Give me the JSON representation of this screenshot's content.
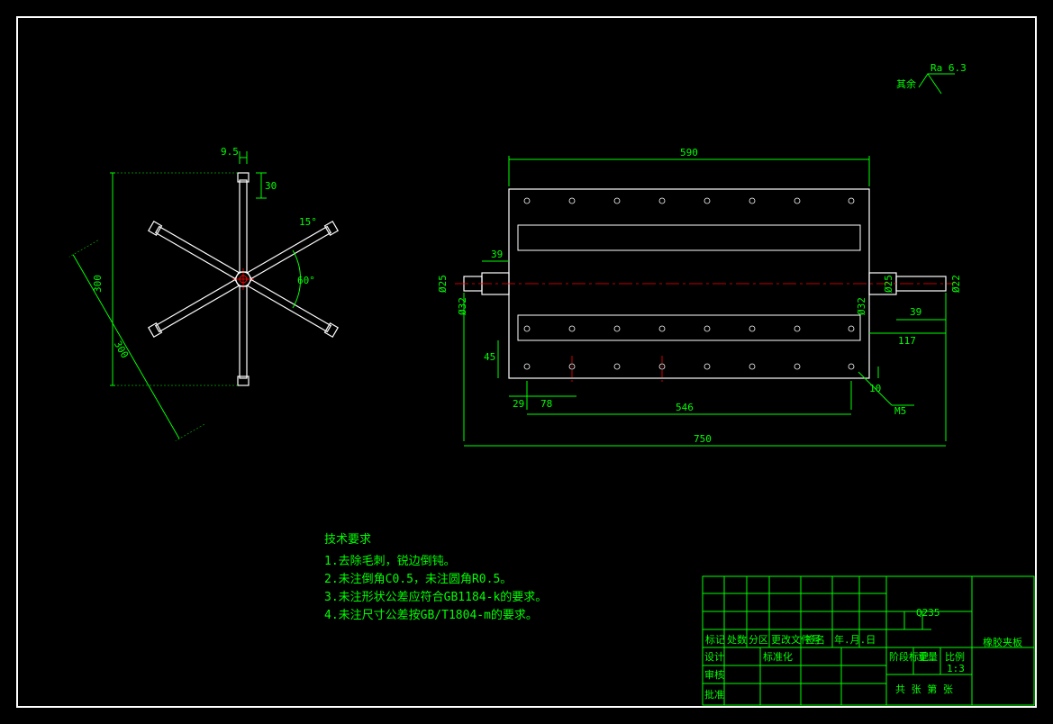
{
  "surface_finish": {
    "label": "其余",
    "value": "Ra 6.3"
  },
  "left_view": {
    "dims": {
      "vert_300": "300",
      "top_30": "30",
      "top_9_5": "9.5",
      "angle_60": "60°",
      "angle_15": "15°",
      "diag_300": "300"
    }
  },
  "right_view": {
    "dims": {
      "top_590": "590",
      "bottom_750": "750",
      "bottom_546": "546",
      "left_39": "39",
      "left_45": "45",
      "left_29": "29",
      "left_78": "78",
      "right_117": "117",
      "right_39": "39",
      "right_10": "10",
      "dia_25": "Ø25",
      "dia_32_l": "Ø32",
      "dia_32_r": "Ø32",
      "dia_22": "Ø22",
      "dia_25_r": "Ø25",
      "m5": "M5"
    }
  },
  "notes": {
    "title": "技术要求",
    "items": [
      "1.去除毛刺，锐边倒钝。",
      "2.未注倒角C0.5，未注圆角R0.5。",
      "3.未注形状公差应符合GB1184-k的要求。",
      "4.未注尺寸公差按GB/T1804-m的要求。"
    ]
  },
  "title_block": {
    "material": "Q235",
    "part_name": "橡胶夹板",
    "scale": "1:3",
    "labels": {
      "mark": "标记",
      "num": "处数",
      "div": "分区",
      "file": "更改文件号",
      "sign": "签名",
      "date": "年.月.日",
      "design": "设计",
      "std": "标准化",
      "check": "审核",
      "appr": "批准",
      "stage": "阶段标记",
      "weight": "重量",
      "ratio": "比例",
      "sheet": "共   张  第   张"
    }
  }
}
